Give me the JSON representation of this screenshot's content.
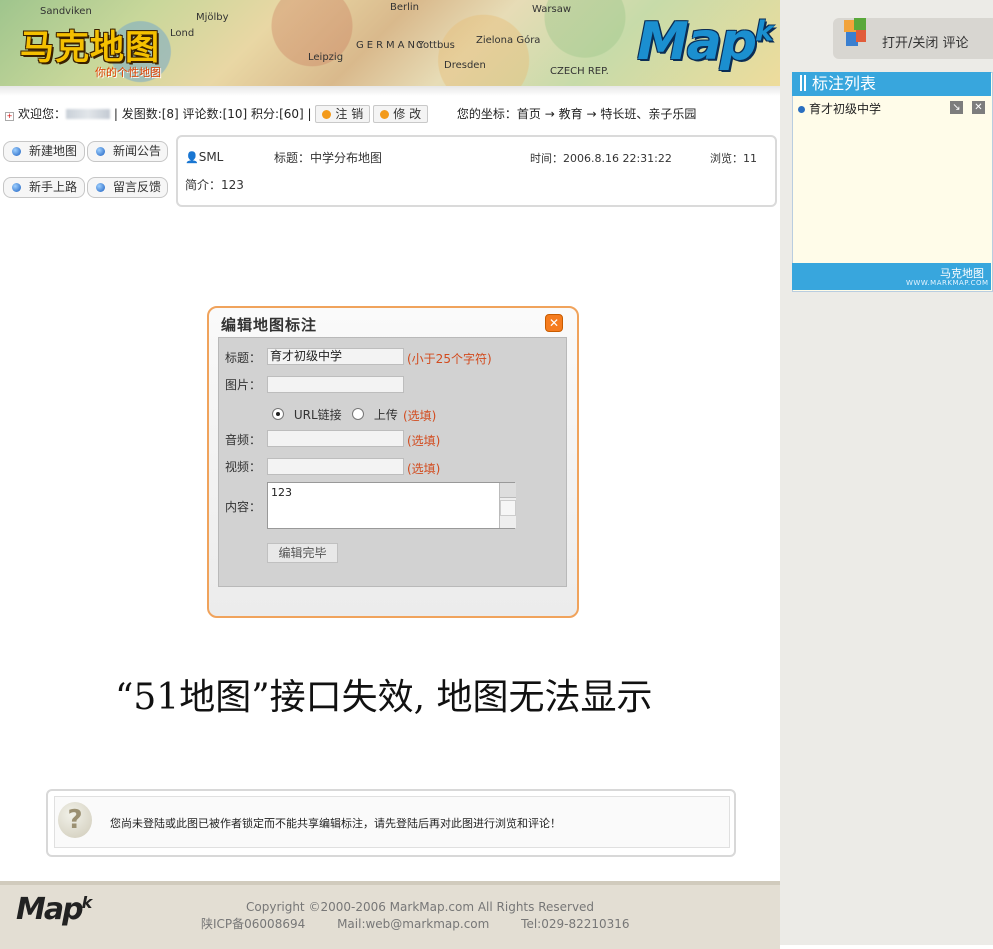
{
  "header": {
    "logo_cn": "马克地图",
    "slogan": "你的个性地图",
    "logo_en": "Map",
    "logo_en_sup": "k",
    "map_labels": [
      "Sandviken",
      "Mjölby",
      "Berlin",
      "Warsaw",
      "Lond",
      "Zielona Góra",
      "Cottbus",
      "Leipzig",
      "Dresden",
      "GERMANY",
      "CZECH REP."
    ]
  },
  "sidebar": {
    "toggle_label": "打开/关闭 评论",
    "list_title": "标注列表",
    "items": [
      {
        "label": "育才初级中学"
      }
    ],
    "footer_cn": "马克地图",
    "footer_url": "WWW.MARKMAP.COM"
  },
  "userbar": {
    "welcome": "欢迎您：",
    "stats": "| 发图数:[8] 评论数:[10] 积分:[60] |",
    "logout": "注 销",
    "modify": "修 改",
    "location_label": "您的坐标：",
    "crumbs": [
      "首页",
      "教育",
      "特长班、亲子乐园"
    ],
    "arrow": "→"
  },
  "nav": {
    "new_map": "新建地图",
    "news": "新闻公告",
    "guide": "新手上路",
    "feedback": "留言反馈"
  },
  "info": {
    "author": "SML",
    "title": "标题：中学分布地图",
    "time": "时间：2006.8.16 22:31:22",
    "views": "浏览：11",
    "intro": "简介：123"
  },
  "dialog": {
    "title": "编辑地图标注",
    "close": "✕",
    "title_label": "标题：",
    "title_value": "育才初级中学",
    "title_hint": "(小于25个字符)",
    "image_label": "图片：",
    "radio_url": "URL链接",
    "radio_upload": "上传",
    "optional": "(选填)",
    "audio_label": "音频：",
    "video_label": "视频：",
    "content_label": "内容：",
    "content_value": "123",
    "done": "编辑完毕"
  },
  "map_error": "“51地图”接口失效, 地图无法显示",
  "notice": {
    "icon": "?",
    "text": "您尚未登陆或此图已被作者锁定而不能共享编辑标注，请先登陆后再对此图进行浏览和评论！"
  },
  "footer": {
    "logo": "Map",
    "logo_sup": "k",
    "copyright": "Copyright ©2000-2006 MarkMap.com All Rights Reserved",
    "icp": "陕ICP备06008694",
    "mail": "Mail:web@markmap.com",
    "tel": "Tel:029-82210316"
  },
  "colors": {
    "accent_blue": "#38a6dd",
    "dialog_border": "#f0a35c",
    "hint_red": "#d24b1e",
    "footer_bg": "#e3ded3"
  }
}
